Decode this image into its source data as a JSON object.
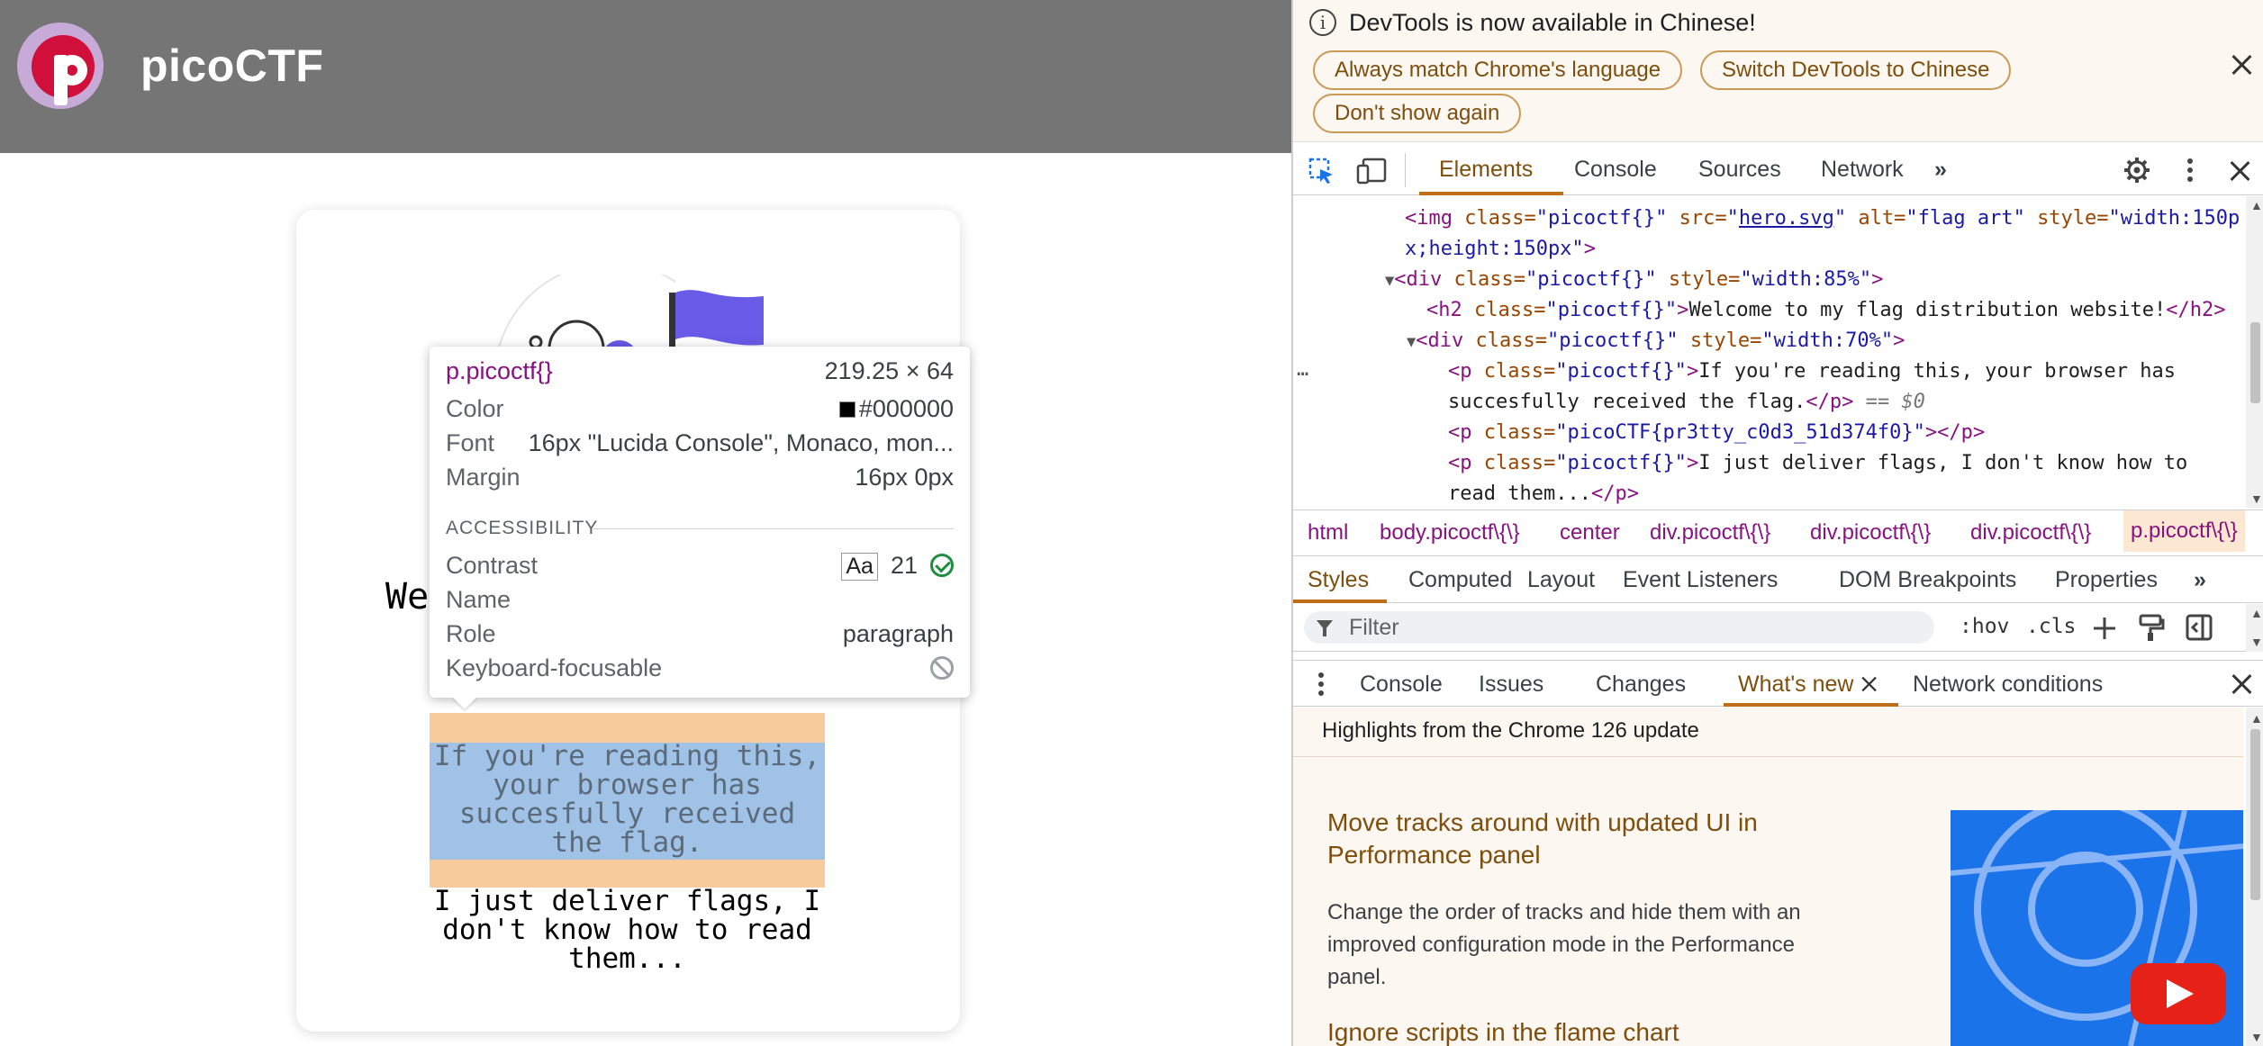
{
  "page": {
    "site_title": "picoCTF",
    "heading_fragment": "We",
    "flag_paragraph": "If you're reading this, your browser has succesfully received the flag.",
    "deliver_paragraph": "I just deliver flags, I don't know how to read them..."
  },
  "tooltip": {
    "selector": "p.picoctf{}",
    "dimensions": "219.25 × 64",
    "color_label": "Color",
    "color_value": "#000000",
    "font_label": "Font",
    "font_value": "16px \"Lucida Console\", Monaco, mon...",
    "margin_label": "Margin",
    "margin_value": "16px 0px",
    "accessibility_label": "ACCESSIBILITY",
    "contrast_label": "Contrast",
    "contrast_aa": "Aa",
    "contrast_value": "21",
    "name_label": "Name",
    "role_label": "Role",
    "role_value": "paragraph",
    "keyboard_label": "Keyboard-focusable"
  },
  "infobar": {
    "message": "DevTools is now available in Chinese!",
    "btn_match": "Always match Chrome's language",
    "btn_switch": "Switch DevTools to Chinese",
    "btn_dont_show": "Don't show again"
  },
  "main_tabs": [
    "Elements",
    "Console",
    "Sources",
    "Network"
  ],
  "dom": {
    "img_tag": "<img",
    "img_class_attr": "class=",
    "img_class_val": "\"picoctf{}\"",
    "img_src_attr": "src=",
    "img_src_val": "hero.svg",
    "img_alt_attr": "alt=",
    "img_alt_val": "\"flag art\"",
    "img_style_attr": "style=",
    "img_style_val_1": "\"width:150p",
    "img_style_val_2": "x;height:150px\"",
    "div1_class": "\"picoctf{}\"",
    "div1_style": "\"width:85%\"",
    "h2_class": "\"picoctf{}\"",
    "h2_text": "Welcome to my flag distribution website!",
    "div2_class": "\"picoctf{}\"",
    "div2_style": "\"width:70%\"",
    "p1_class": "\"picoctf{}\"",
    "p1_text_1": "If you're reading this, your browser has",
    "p1_text_2": "succesfully received the flag.",
    "p1_eq": "== $0",
    "p2_class": "\"picoCTF{pr3tty_c0d3_51d374f0}\"",
    "p3_class": "\"picoctf{}\"",
    "p3_text_1": "I just deliver flags, I don't know how to",
    "p3_text_2": "read them..."
  },
  "breadcrumbs": [
    "html",
    "body.picoctf\\{\\}",
    "center",
    "div.picoctf\\{\\}",
    "div.picoctf\\{\\}",
    "div.picoctf\\{\\}",
    "p.picoctf\\{\\}"
  ],
  "sub_tabs": [
    "Styles",
    "Computed",
    "Layout",
    "Event Listeners",
    "DOM Breakpoints",
    "Properties"
  ],
  "filter": {
    "placeholder": "Filter",
    "hov": ":hov",
    "cls": ".cls"
  },
  "drawer_tabs": [
    "Console",
    "Issues",
    "Changes",
    "What's new",
    "Network conditions"
  ],
  "whats_new": {
    "subtitle": "Highlights from the Chrome 126 update",
    "heading1": "Move tracks around with updated UI in Performance panel",
    "body1": "Change the order of tracks and hide them with an improved configuration mode in the Performance panel.",
    "heading2": "Ignore scripts in the flame chart"
  },
  "colors": {
    "accent": "#c06d18",
    "tag": "#881280",
    "attr_name": "#994500",
    "attr_value": "#1a1aa6",
    "brand_red": "#d0103a"
  }
}
